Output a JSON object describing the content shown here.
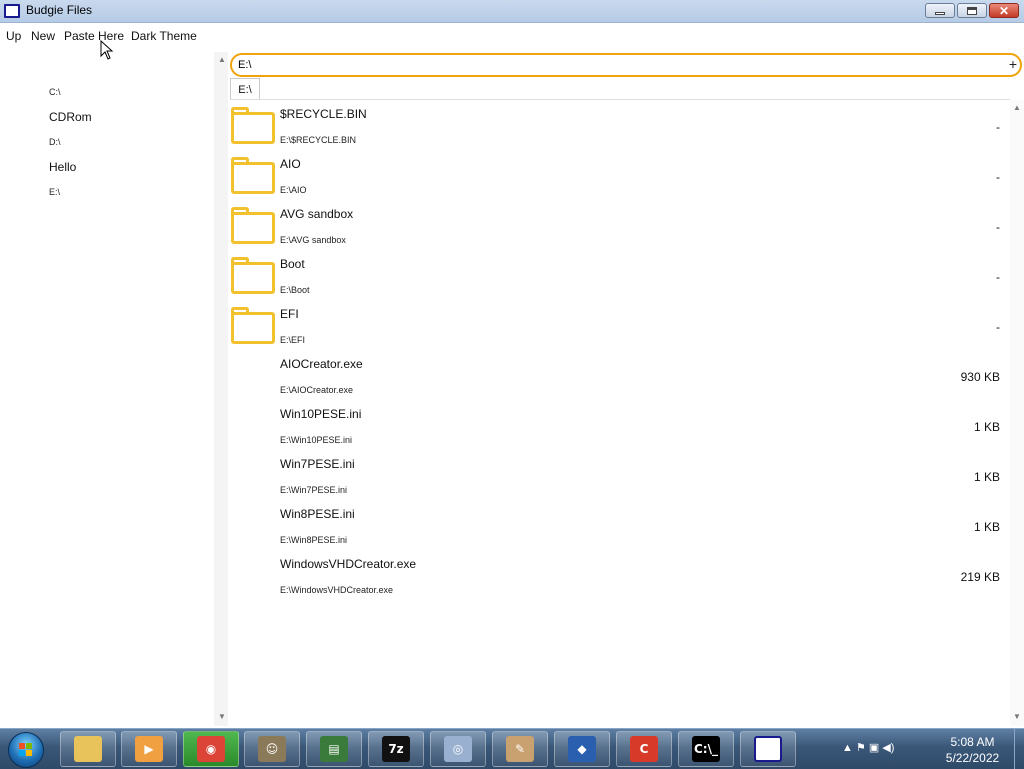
{
  "window": {
    "title": "Budgie Files"
  },
  "menu": {
    "up": "Up",
    "new": "New",
    "paste_here": "Paste Here",
    "dark_theme": "Dark Theme"
  },
  "sidebar": {
    "items": [
      {
        "label": "C:\\",
        "style": "small"
      },
      {
        "label": "CDRom",
        "style": "big"
      },
      {
        "label": "D:\\",
        "style": "small"
      },
      {
        "label": "Hello",
        "style": "big"
      },
      {
        "label": "E:\\",
        "style": "small"
      }
    ]
  },
  "address": {
    "value": "E:\\",
    "add_label": "+"
  },
  "tabs": [
    {
      "label": "E:\\"
    }
  ],
  "files": [
    {
      "name": "$RECYCLE.BIN",
      "path": "E:\\$RECYCLE.BIN",
      "size": "-",
      "type": "folder"
    },
    {
      "name": "AIO",
      "path": "E:\\AIO",
      "size": "-",
      "type": "folder"
    },
    {
      "name": "AVG sandbox",
      "path": "E:\\AVG sandbox",
      "size": "-",
      "type": "folder"
    },
    {
      "name": "Boot",
      "path": "E:\\Boot",
      "size": "-",
      "type": "folder"
    },
    {
      "name": "EFI",
      "path": "E:\\EFI",
      "size": "-",
      "type": "folder"
    },
    {
      "name": "AIOCreator.exe",
      "path": "E:\\AIOCreator.exe",
      "size": "930 KB",
      "type": "file"
    },
    {
      "name": "Win10PESE.ini",
      "path": "E:\\Win10PESE.ini",
      "size": "1 KB",
      "type": "file"
    },
    {
      "name": "Win7PESE.ini",
      "path": "E:\\Win7PESE.ini",
      "size": "1 KB",
      "type": "file"
    },
    {
      "name": "Win8PESE.ini",
      "path": "E:\\Win8PESE.ini",
      "size": "1 KB",
      "type": "file"
    },
    {
      "name": "WindowsVHDCreator.exe",
      "path": "E:\\WindowsVHDCreator.exe",
      "size": "219 KB",
      "type": "file"
    }
  ],
  "taskbar": {
    "apps": [
      {
        "name": "explorer-icon",
        "color": "#e8c25a",
        "glyph": ""
      },
      {
        "name": "media-player-icon",
        "color": "#f0a040",
        "glyph": "▶"
      },
      {
        "name": "chrome-icon",
        "color": "#db4437",
        "glyph": "◉"
      },
      {
        "name": "user-admin-icon",
        "color": "#8a7a5a",
        "glyph": "☺"
      },
      {
        "name": "monitor-icon",
        "color": "#3a7a3a",
        "glyph": "▤"
      },
      {
        "name": "7zip-icon",
        "color": "#111111",
        "glyph": "7z"
      },
      {
        "name": "disc-icon",
        "color": "#9ab0d0",
        "glyph": "◎"
      },
      {
        "name": "paint-icon",
        "color": "#c9a070",
        "glyph": "✎"
      },
      {
        "name": "cube-icon",
        "color": "#2a5fb0",
        "glyph": "◆"
      },
      {
        "name": "ccleaner-icon",
        "color": "#d83a2a",
        "glyph": "C"
      },
      {
        "name": "cmd-icon",
        "color": "#000000",
        "glyph": "C:\\_"
      },
      {
        "name": "budgie-window-icon",
        "color": "#ffffff",
        "glyph": ""
      }
    ],
    "active_index": 2,
    "tray_icons": "▲ ⚑ ▣ ◀)",
    "time": "5:08 AM",
    "date": "5/22/2022"
  },
  "colors": {
    "accent": "#f0a30a",
    "folder": "#f2c12e"
  }
}
